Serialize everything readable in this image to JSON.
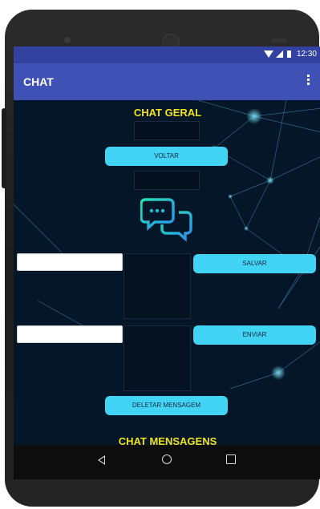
{
  "status_bar": {
    "time": "12:30"
  },
  "app_bar": {
    "title": "CHAT",
    "menu_icon": "overflow-menu-icon"
  },
  "main": {
    "heading_top": "CHAT GERAL",
    "voltar_label": "VOLTAR",
    "chat_icon": "chat-bubbles-icon",
    "salvar_label": "SALVAR",
    "enviar_label": "ENVIAR",
    "deletar_label": "DELETAR MENSAGEM",
    "heading_bottom": "CHAT MENSAGENS",
    "input_1_value": "",
    "input_2_value": ""
  },
  "colors": {
    "status_bar": "#3341a0",
    "app_bar": "#3f51b5",
    "background": "#041627",
    "button": "#42d4f4",
    "heading": "#f2e31a"
  },
  "nav_bar": {
    "back_icon": "back-triangle-icon",
    "home_icon": "home-circle-icon",
    "recent_icon": "recent-apps-square-icon"
  }
}
